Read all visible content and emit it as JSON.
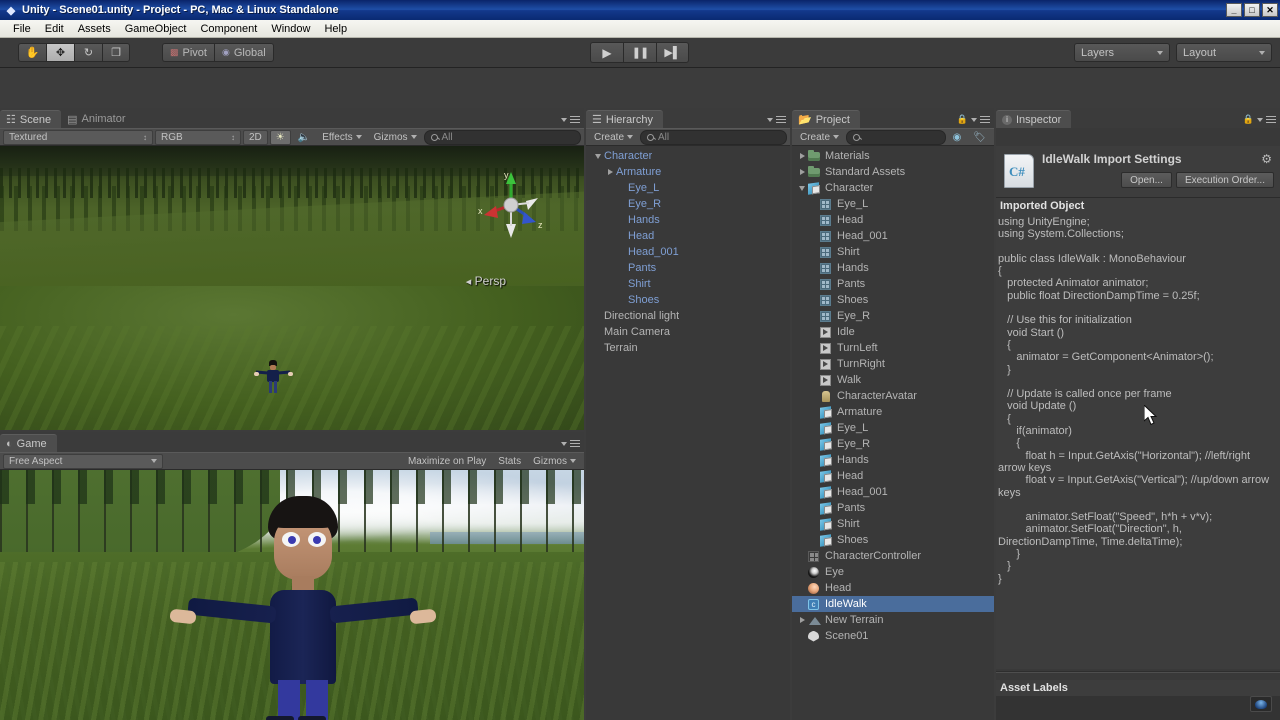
{
  "window": {
    "title": "Unity - Scene01.unity - Project - PC, Mac & Linux Standalone",
    "app_icon": "unity-icon",
    "minimize": "_",
    "maximize": "□",
    "close": "✕"
  },
  "menubar": {
    "items": [
      "File",
      "Edit",
      "Assets",
      "GameObject",
      "Component",
      "Window",
      "Help"
    ]
  },
  "toolbar": {
    "tools": [
      {
        "name": "hand-tool",
        "glyph": "✋",
        "active": false
      },
      {
        "name": "move-tool",
        "glyph": "✥",
        "active": true
      },
      {
        "name": "rotate-tool",
        "glyph": "↻",
        "active": false
      },
      {
        "name": "scale-tool",
        "glyph": "❐",
        "active": false
      }
    ],
    "pivot_label": "Pivot",
    "space_label": "Global",
    "play_label": "▶",
    "pause_label": "❚❚",
    "step_label": "▶▌",
    "layers_label": "Layers",
    "layout_label": "Layout"
  },
  "scene_view": {
    "tab_scene": "Scene",
    "tab_animator": "Animator",
    "draw_mode": "Textured",
    "color_mode": "RGB",
    "toggle_2d": "2D",
    "lighting_icon": "sun-icon",
    "audio_icon": "speaker-icon",
    "effects_label": "Effects",
    "gizmos_label": "Gizmos",
    "search_placeholder": "All",
    "persp_label": "Persp",
    "axis_x": "x",
    "axis_y": "y",
    "axis_z": "z"
  },
  "game_view": {
    "tab_label": "Game",
    "aspect_label": "Free Aspect",
    "maximize_label": "Maximize on Play",
    "stats_label": "Stats",
    "gizmos_label": "Gizmos"
  },
  "hierarchy": {
    "tab_label": "Hierarchy",
    "create_label": "Create",
    "search_placeholder": "All",
    "items": [
      {
        "label": "Character",
        "indent": 0,
        "arrow": "down",
        "prefab": true,
        "icon": "none"
      },
      {
        "label": "Armature",
        "indent": 1,
        "arrow": "right",
        "prefab": true,
        "icon": "none"
      },
      {
        "label": "Eye_L",
        "indent": 2,
        "arrow": "none",
        "prefab": true,
        "icon": "none"
      },
      {
        "label": "Eye_R",
        "indent": 2,
        "arrow": "none",
        "prefab": true,
        "icon": "none"
      },
      {
        "label": "Hands",
        "indent": 2,
        "arrow": "none",
        "prefab": true,
        "icon": "none"
      },
      {
        "label": "Head",
        "indent": 2,
        "arrow": "none",
        "prefab": true,
        "icon": "none"
      },
      {
        "label": "Head_001",
        "indent": 2,
        "arrow": "none",
        "prefab": true,
        "icon": "none"
      },
      {
        "label": "Pants",
        "indent": 2,
        "arrow": "none",
        "prefab": true,
        "icon": "none"
      },
      {
        "label": "Shirt",
        "indent": 2,
        "arrow": "none",
        "prefab": true,
        "icon": "none"
      },
      {
        "label": "Shoes",
        "indent": 2,
        "arrow": "none",
        "prefab": true,
        "icon": "none"
      },
      {
        "label": "Directional light",
        "indent": 0,
        "arrow": "none",
        "prefab": false,
        "icon": "none"
      },
      {
        "label": "Main Camera",
        "indent": 0,
        "arrow": "none",
        "prefab": false,
        "icon": "none"
      },
      {
        "label": "Terrain",
        "indent": 0,
        "arrow": "none",
        "prefab": false,
        "icon": "none"
      }
    ]
  },
  "project": {
    "tab_label": "Project",
    "create_label": "Create",
    "search_placeholder": "",
    "lock_icon": "lock-icon",
    "filter_icon": "filter-icon",
    "label_icon": "label-icon",
    "items": [
      {
        "label": "Materials",
        "indent": 0,
        "arrow": "right",
        "icon": "folder",
        "selected": false
      },
      {
        "label": "Standard Assets",
        "indent": 0,
        "arrow": "right",
        "icon": "folder",
        "selected": false
      },
      {
        "label": "Character",
        "indent": 0,
        "arrow": "down",
        "icon": "prefab",
        "selected": false
      },
      {
        "label": "Eye_L",
        "indent": 1,
        "arrow": "none",
        "icon": "mesh",
        "selected": false
      },
      {
        "label": "Head",
        "indent": 1,
        "arrow": "none",
        "icon": "mesh",
        "selected": false
      },
      {
        "label": "Head_001",
        "indent": 1,
        "arrow": "none",
        "icon": "mesh",
        "selected": false
      },
      {
        "label": "Shirt",
        "indent": 1,
        "arrow": "none",
        "icon": "mesh",
        "selected": false
      },
      {
        "label": "Hands",
        "indent": 1,
        "arrow": "none",
        "icon": "mesh",
        "selected": false
      },
      {
        "label": "Pants",
        "indent": 1,
        "arrow": "none",
        "icon": "mesh",
        "selected": false
      },
      {
        "label": "Shoes",
        "indent": 1,
        "arrow": "none",
        "icon": "mesh",
        "selected": false
      },
      {
        "label": "Eye_R",
        "indent": 1,
        "arrow": "none",
        "icon": "mesh",
        "selected": false
      },
      {
        "label": "Idle",
        "indent": 1,
        "arrow": "none",
        "icon": "anim",
        "selected": false
      },
      {
        "label": "TurnLeft",
        "indent": 1,
        "arrow": "none",
        "icon": "anim",
        "selected": false
      },
      {
        "label": "TurnRight",
        "indent": 1,
        "arrow": "none",
        "icon": "anim",
        "selected": false
      },
      {
        "label": "Walk",
        "indent": 1,
        "arrow": "none",
        "icon": "anim",
        "selected": false
      },
      {
        "label": "CharacterAvatar",
        "indent": 1,
        "arrow": "none",
        "icon": "avatar",
        "selected": false
      },
      {
        "label": "Armature",
        "indent": 1,
        "arrow": "none",
        "icon": "prefab",
        "selected": false
      },
      {
        "label": "Eye_L",
        "indent": 1,
        "arrow": "none",
        "icon": "prefab",
        "selected": false
      },
      {
        "label": "Eye_R",
        "indent": 1,
        "arrow": "none",
        "icon": "prefab",
        "selected": false
      },
      {
        "label": "Hands",
        "indent": 1,
        "arrow": "none",
        "icon": "prefab",
        "selected": false
      },
      {
        "label": "Head",
        "indent": 1,
        "arrow": "none",
        "icon": "prefab",
        "selected": false
      },
      {
        "label": "Head_001",
        "indent": 1,
        "arrow": "none",
        "icon": "prefab",
        "selected": false
      },
      {
        "label": "Pants",
        "indent": 1,
        "arrow": "none",
        "icon": "prefab",
        "selected": false
      },
      {
        "label": "Shirt",
        "indent": 1,
        "arrow": "none",
        "icon": "prefab",
        "selected": false
      },
      {
        "label": "Shoes",
        "indent": 1,
        "arrow": "none",
        "icon": "prefab",
        "selected": false
      },
      {
        "label": "CharacterController",
        "indent": 0,
        "arrow": "none",
        "icon": "controller",
        "selected": false
      },
      {
        "label": "Eye",
        "indent": 0,
        "arrow": "none",
        "icon": "mat-eye",
        "selected": false
      },
      {
        "label": "Head",
        "indent": 0,
        "arrow": "none",
        "icon": "mat-head",
        "selected": false
      },
      {
        "label": "IdleWalk",
        "indent": 0,
        "arrow": "none",
        "icon": "script",
        "selected": true
      },
      {
        "label": "New Terrain",
        "indent": 0,
        "arrow": "right",
        "icon": "terrain",
        "selected": false
      },
      {
        "label": "Scene01",
        "indent": 0,
        "arrow": "none",
        "icon": "unity",
        "selected": false
      }
    ]
  },
  "inspector": {
    "tab_label": "Inspector",
    "lock_icon": "lock-icon",
    "title": "IdleWalk Import Settings",
    "file_icon_text": "C#",
    "gear_icon": "gear-icon",
    "open_label": "Open...",
    "execution_order_label": "Execution Order...",
    "imported_object_label": "Imported Object",
    "code": "using UnityEngine;\nusing System.Collections;\n\npublic class IdleWalk : MonoBehaviour\n{\n   protected Animator animator;\n   public float DirectionDampTime = 0.25f;\n\n   // Use this for initialization\n   void Start ()\n   {\n      animator = GetComponent<Animator>();\n   }\n\n   // Update is called once per frame\n   void Update ()\n   {\n      if(animator)\n      {\n         float h = Input.GetAxis(\"Horizontal\"); //left/right arrow keys\n         float v = Input.GetAxis(\"Vertical\"); //up/down arrow keys\n\n         animator.SetFloat(\"Speed\", h*h + v*v);\n         animator.SetFloat(\"Direction\", h, DirectionDampTime, Time.deltaTime);\n      }\n   }\n}",
    "asset_labels_label": "Asset Labels"
  },
  "colors": {
    "selection_blue": "#4a6d9c",
    "prefab_blue": "#7f9fd4",
    "panel_bg": "#393939",
    "titlebar_blue": "#0a246a"
  }
}
